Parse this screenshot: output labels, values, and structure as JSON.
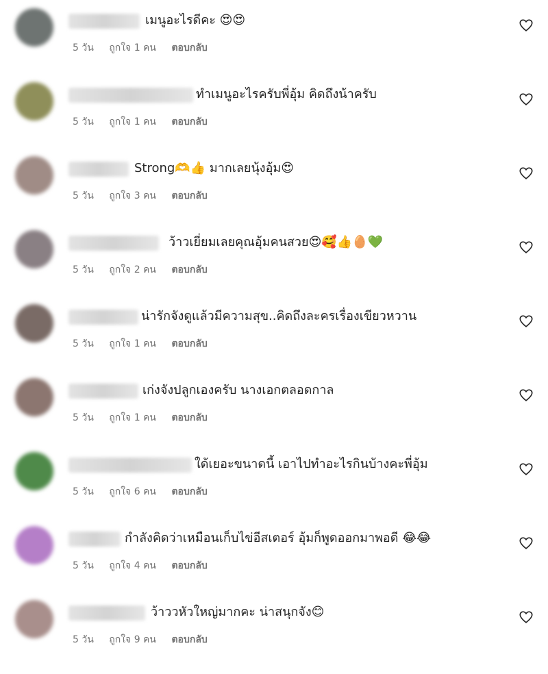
{
  "comments": [
    {
      "avatar_color": "#6e7472",
      "text": "เมนูอะไรดีคะ 😍😍",
      "time": "5 วัน",
      "likes": "ถูกใจ 1 คน",
      "reply": "ตอบกลับ"
    },
    {
      "avatar_color": "#8f8f5a",
      "text": "ทำเมนูอะไรครับพี่อุ้ม คิดถึงน้าครับ",
      "time": "5 วัน",
      "likes": "ถูกใจ 1 คน",
      "reply": "ตอบกลับ"
    },
    {
      "avatar_color": "#a08c86",
      "text": "Strong🫶👍 มากเลยนุ้งอุ้ม😍",
      "time": "5 วัน",
      "likes": "ถูกใจ 3 คน",
      "reply": "ตอบกลับ"
    },
    {
      "avatar_color": "#8a8084",
      "text": "ว้าวเยี่ยมเลยคุณอุ้มคนสวย😍🥰👍🥚💚",
      "time": "5 วัน",
      "likes": "ถูกใจ 2 คน",
      "reply": "ตอบกลับ"
    },
    {
      "avatar_color": "#7a6b66",
      "text": "น่ารักจังดูแล้วมีความสุข..คิดถึงละครเรื่องเขียวหวาน",
      "time": "5 วัน",
      "likes": "ถูกใจ 1 คน",
      "reply": "ตอบกลับ"
    },
    {
      "avatar_color": "#8c7670",
      "text": "เก่งจังปลูกเองครับ นางเอกตลอดกาล",
      "time": "5 วัน",
      "likes": "ถูกใจ 1 คน",
      "reply": "ตอบกลับ"
    },
    {
      "avatar_color": "#4f8a4a",
      "text": "ใด้เยอะขนาดนี้ เอาไปทำอะไรกินบ้างคะพี่อุ้ม",
      "time": "5 วัน",
      "likes": "ถูกใจ 6 คน",
      "reply": "ตอบกลับ"
    },
    {
      "avatar_color": "#b57fc8",
      "text": "กำลังคิดว่าเหมือนเก็บไข่อีสเตอร์ อุ้มก็พูดออกมาพอดี 😂😂",
      "time": "5 วัน",
      "likes": "ถูกใจ 4 คน",
      "reply": "ตอบกลับ"
    },
    {
      "avatar_color": "#a98f8c",
      "text": "ว้าววหัวใหญ่มากคะ น่าสนุกจัง😊",
      "time": "5 วัน",
      "likes": "ถูกใจ 9 คน",
      "reply": "ตอบกลับ"
    }
  ]
}
